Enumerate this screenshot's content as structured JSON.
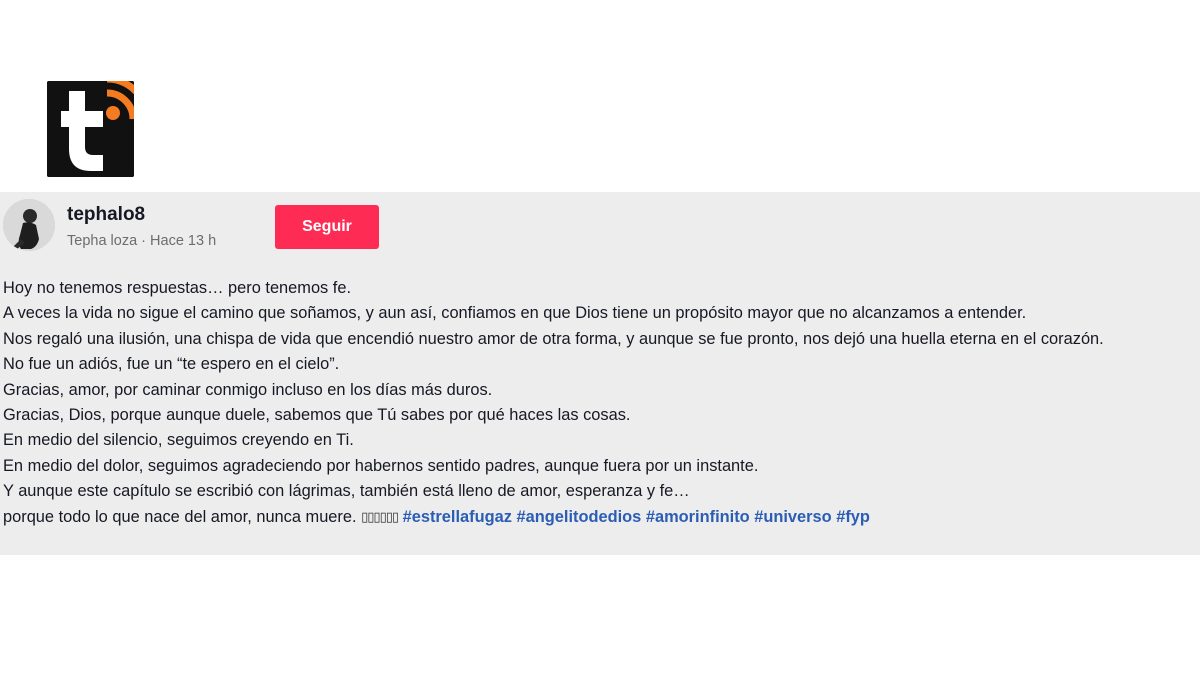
{
  "logo": {
    "letter": "t",
    "accent_color": "#f47b20",
    "background_color": "#111111"
  },
  "post": {
    "username": "tephalo8",
    "display_name": "Tepha loza",
    "separator": "·",
    "time_ago": "Hace 13 h",
    "follow_label": "Seguir",
    "follow_color": "#fe2c55",
    "caption_lines": [
      "Hoy no tenemos respuestas… pero tenemos fe.",
      "A veces la vida no sigue el camino que soñamos, y aun así, confiamos en que Dios tiene un propósito mayor que no alcanzamos a entender.",
      "Nos regaló una ilusión, una chispa de vida que encendió nuestro amor de otra forma, y aunque se fue pronto, nos dejó una huella eterna en el corazón.",
      "No fue un adiós, fue un “te espero en el cielo”.",
      "Gracias, amor, por caminar conmigo incluso en los días más duros.",
      "Gracias, Dios, porque aunque duele, sabemos que Tú sabes por qué haces las cosas.",
      "En medio del silencio, seguimos creyendo en Ti.",
      "En medio del dolor, seguimos agradeciendo por habernos sentido padres, aunque fuera por un instante.",
      "Y aunque este capítulo se escribió con lágrimas, también está lleno de amor, esperanza y fe…"
    ],
    "last_line_text": "porque todo lo que nace del amor, nunca muere.",
    "emoji_placeholder": "▯▯▯▯▯▯",
    "hashtags": [
      "#estrellafugaz",
      "#angelitodedios",
      "#amorinfinito",
      "#universo",
      "#fyp"
    ],
    "hashtag_color": "#2b5db5"
  }
}
